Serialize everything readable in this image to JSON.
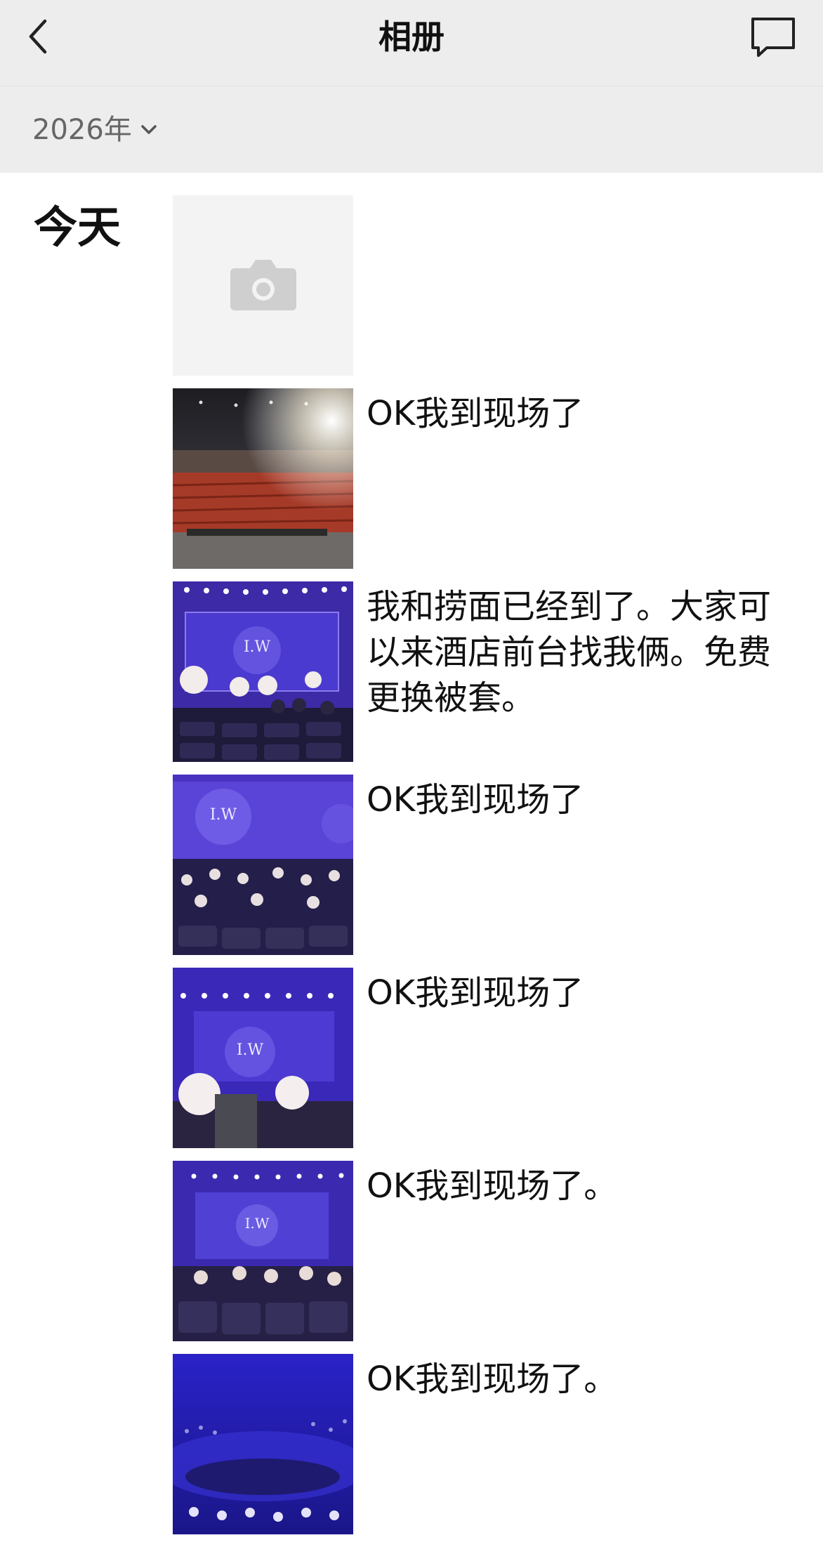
{
  "header": {
    "title": "相册",
    "back_icon": "chevron-left-icon",
    "message_icon": "message-bubble-icon",
    "background": "#ededed"
  },
  "year_filter": {
    "label": "2026年",
    "icon": "chevron-down-icon"
  },
  "timeline": {
    "day_label": "今天",
    "posts": [
      {
        "kind": "camera-placeholder",
        "caption": ""
      },
      {
        "kind": "photo-empty-theater",
        "caption": "OK我到现场了"
      },
      {
        "kind": "photo-concert-stage",
        "caption": "我和捞面已经到了。大家可以来酒店前台找我俩。免费更换被套。"
      },
      {
        "kind": "photo-concert-stage",
        "caption": "OK我到现场了"
      },
      {
        "kind": "photo-concert-stage",
        "caption": "OK我到现场了"
      },
      {
        "kind": "photo-concert-stage",
        "caption": "OK我到现场了。"
      },
      {
        "kind": "photo-concert-hall-blue",
        "caption": "OK我到现场了。"
      }
    ]
  }
}
